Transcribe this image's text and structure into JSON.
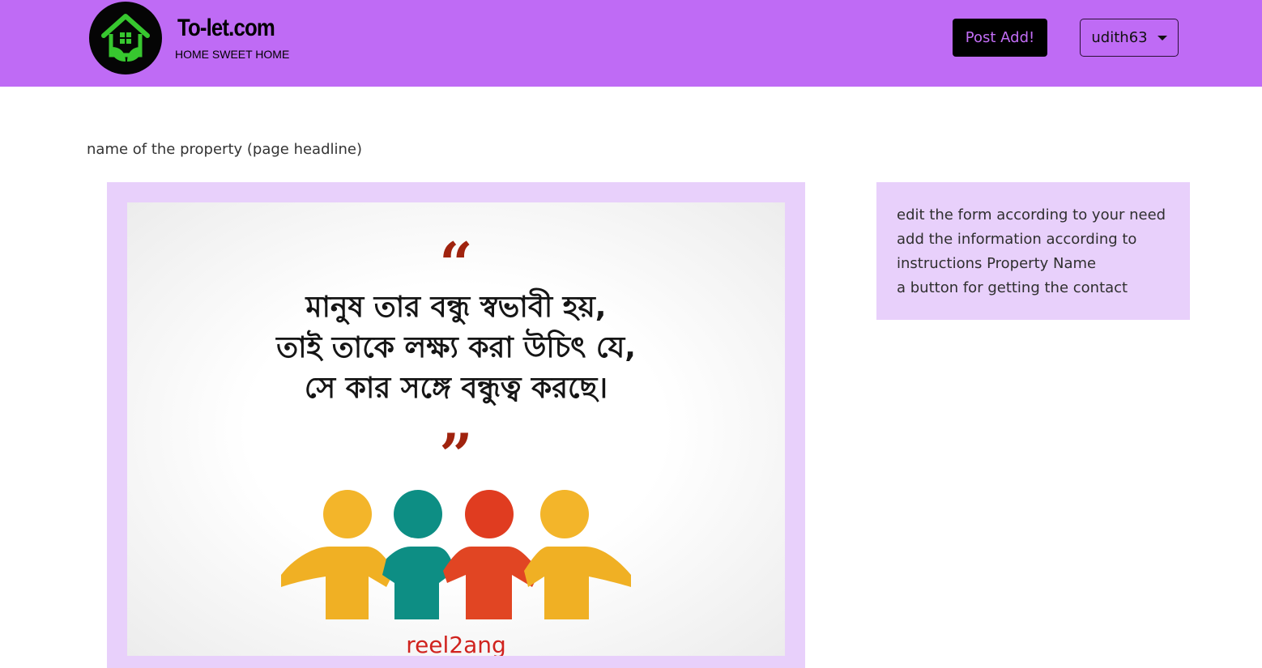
{
  "navbar": {
    "logo_icon": "house-leaf-icon",
    "brand_title": "To-let.com",
    "brand_tagline": "HOME SWEET HOME",
    "post_button_label": "Post Add!",
    "user_menu_label": "udith63",
    "colors": {
      "navbar_bg": "#bf6bf5",
      "post_button_bg": "#000000",
      "post_button_text": "#c26df5"
    }
  },
  "page": {
    "headline": "name of the property (page headline)"
  },
  "image": {
    "open_quote": "“",
    "quote_lines": [
      "মানুষ তার বন্ধু স্বভাবী হয়,",
      "তাই তাকে লক্ষ্য করা উচিৎ যে,",
      "সে কার সঙ্গে বন্ধুত্ব করছে।"
    ],
    "close_quote": "”",
    "caption": "reel2ang",
    "people_colors": [
      "#f3b52a",
      "#0d8e84",
      "#e03c20",
      "#f3b52a"
    ]
  },
  "info_box": {
    "lines": [
      "edit the form according to your need",
      "add the information according to",
      "instructions Property Name",
      "a button for getting the contact"
    ],
    "bg_color": "#e8d0fb"
  }
}
